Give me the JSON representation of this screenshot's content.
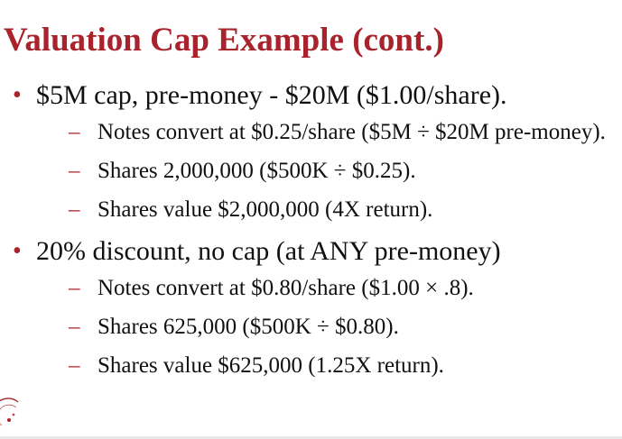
{
  "slide": {
    "title": "Valuation Cap Example (cont.)",
    "bullets": [
      {
        "text": "$5M cap, pre-money - $20M ($1.00/share).",
        "subs": [
          "Notes convert at $0.25/share ($5M ÷ $20M pre-money).",
          "Shares 2,000,000 ($500K ÷ $0.25).",
          "Shares value $2,000,000 (4X return)."
        ]
      },
      {
        "text": "20% discount, no cap (at ANY pre-money)",
        "subs": [
          "Notes convert at $0.80/share ($1.00 × .8).",
          "Shares 625,000 ($500K ÷ $0.80).",
          "Shares value $625,000 (1.25X return)."
        ]
      }
    ],
    "bullet_glyph": "•",
    "sub_glyph": "–",
    "colors": {
      "accent": "#a8232b",
      "text": "#111111",
      "background": "#ffffff"
    },
    "logo_icon": "university-seal-icon"
  }
}
